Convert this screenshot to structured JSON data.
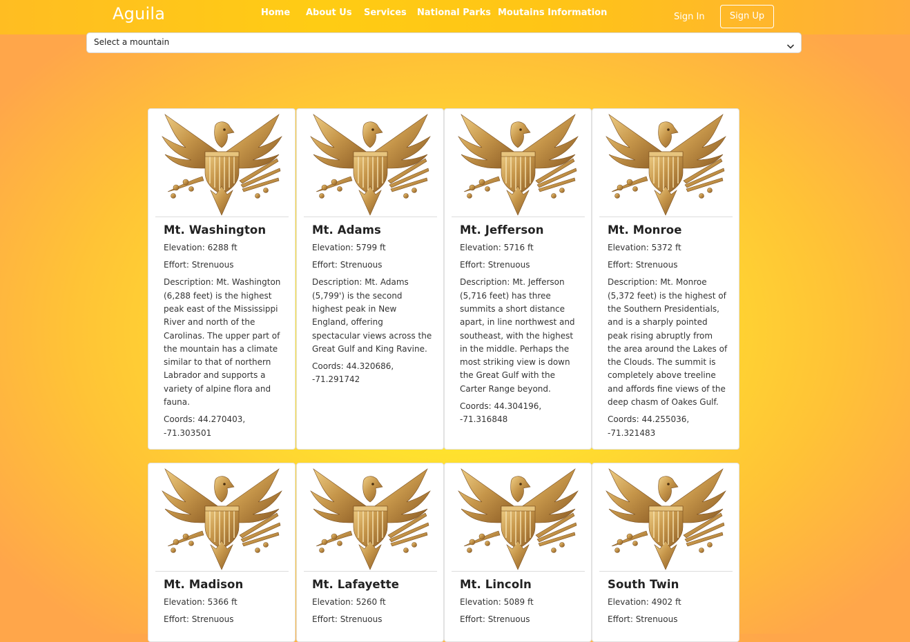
{
  "brand": "Aguila",
  "nav": {
    "links": [
      "Home",
      "About Us",
      "Services",
      "National Parks",
      "Moutains Information"
    ],
    "sign_in": "Sign In",
    "sign_up": "Sign Up"
  },
  "selector": {
    "value": "Select a mountain"
  },
  "colors": {
    "accent_gold": "#c89b4a",
    "navbar": "#ffc516",
    "background_center": "#fff12a"
  },
  "cards": [
    {
      "title": "Mt. Washington",
      "elevation": "Elevation: 6288 ft",
      "effort": "Effort: Strenuous",
      "description": "Description: Mt. Washington (6,288 feet) is the highest peak east of the Mississippi River and north of the Carolinas. The upper part of the mountain has a climate similar to that of northern Labrador and supports a variety of alpine flora and fauna.",
      "coords": "Coords: 44.270403, -71.303501"
    },
    {
      "title": "Mt. Adams",
      "elevation": "Elevation: 5799 ft",
      "effort": "Effort: Strenuous",
      "description": "Description: Mt. Adams (5,799') is the second highest peak in New England, offering spectacular views across the Great Gulf and King Ravine.",
      "coords": "Coords: 44.320686, -71.291742"
    },
    {
      "title": "Mt. Jefferson",
      "elevation": "Elevation: 5716 ft",
      "effort": "Effort: Strenuous",
      "description": "Description: Mt. Jefferson (5,716 feet) has three summits a short distance apart, in line northwest and southeast, with the highest in the middle. Perhaps the most striking view is down the Great Gulf with the Carter Range beyond.",
      "coords": "Coords: 44.304196, -71.316848"
    },
    {
      "title": "Mt. Monroe",
      "elevation": "Elevation: 5372 ft",
      "effort": "Effort: Strenuous",
      "description": "Description: Mt. Monroe (5,372 feet) is the highest of the Southern Presidentials, and is a sharply pointed peak rising abruptly from the area around the Lakes of the Clouds. The summit is completely above treeline and affords fine views of the deep chasm of Oakes Gulf.",
      "coords": "Coords: 44.255036, -71.321483"
    },
    {
      "title": "Mt. Madison",
      "elevation": "Elevation: 5366 ft",
      "effort": "Effort: Strenuous"
    },
    {
      "title": "Mt. Lafayette",
      "elevation": "Elevation: 5260 ft",
      "effort": "Effort: Strenuous"
    },
    {
      "title": "Mt. Lincoln",
      "elevation": "Elevation: 5089 ft",
      "effort": "Effort: Strenuous"
    },
    {
      "title": "South Twin",
      "elevation": "Elevation: 4902 ft",
      "effort": "Effort: Strenuous"
    }
  ]
}
